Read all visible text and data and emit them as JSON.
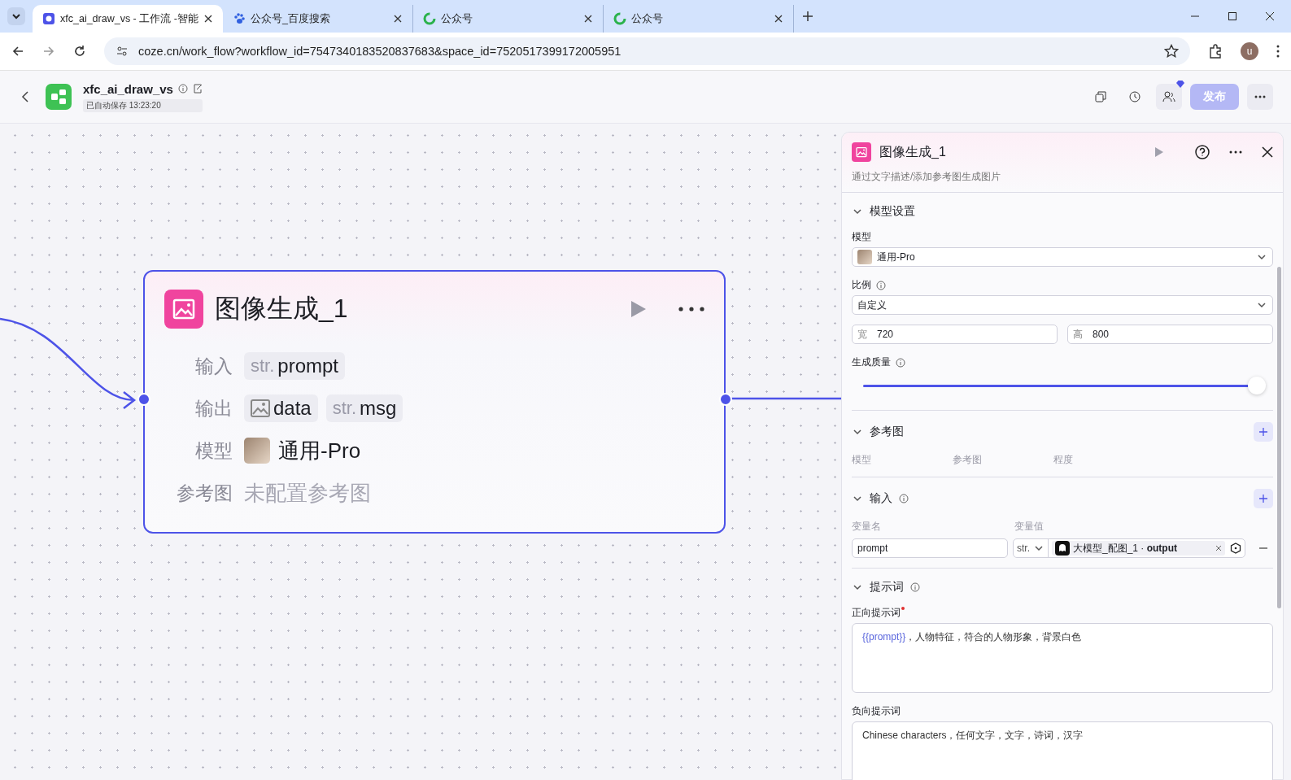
{
  "browser": {
    "tabs": [
      {
        "title": "xfc_ai_draw_vs - 工作流 -智能",
        "selected": true
      },
      {
        "title": "公众号_百度搜索",
        "selected": false
      },
      {
        "title": "公众号",
        "selected": false
      },
      {
        "title": "公众号",
        "selected": false
      }
    ],
    "url": "coze.cn/work_flow?workflow_id=7547340183520837683&space_id=7520517399172005951",
    "profile": "u"
  },
  "header": {
    "title": "xfc_ai_draw_vs",
    "autosave": "已自动保存 13:23:20",
    "publish": "发布"
  },
  "node": {
    "title": "图像生成_1",
    "rows": [
      {
        "label": "输入",
        "values": [
          {
            "kind": "str",
            "prefix": "str.",
            "name": "prompt"
          }
        ]
      },
      {
        "label": "输出",
        "values": [
          {
            "kind": "image",
            "name": "data"
          },
          {
            "kind": "str",
            "prefix": "str.",
            "name": "msg"
          }
        ]
      },
      {
        "label": "模型",
        "values": [
          {
            "kind": "model",
            "name": "通用-Pro"
          }
        ]
      },
      {
        "label": "参考图",
        "values": [
          {
            "kind": "empty",
            "name": "未配置参考图"
          }
        ]
      }
    ]
  },
  "panel": {
    "title": "图像生成_1",
    "description": "通过文字描述/添加参考图生成图片",
    "sections": [
      {
        "kind": "model",
        "title": "模型设置",
        "expanded": true,
        "model_label": "模型",
        "model_value": "通用-Pro",
        "ratio_label": "比例",
        "ratio_value": "自定义",
        "width": {
          "label": "宽",
          "value": "720"
        },
        "height": {
          "label": "高",
          "value": "800"
        },
        "quality_label": "生成质量",
        "level": 1
      },
      {
        "kind": "reference",
        "title": "参考图",
        "expanded": true,
        "columns": [
          "模型",
          "参考图",
          "程度"
        ]
      },
      {
        "kind": "input",
        "title": "输入",
        "expanded": true,
        "columns": [
          "变量名",
          "变量值"
        ],
        "rows": [
          {
            "name": "prompt",
            "type": "str.",
            "source": "大模型_配图_1 · **output**"
          }
        ]
      },
      {
        "kind": "prompt",
        "title": "提示词",
        "expanded": true,
        "positive_label": "正向提示词",
        "positive_required": true,
        "positive_variable": "{{prompt}}",
        "positive_text": "，人物特征，符合的人物形象，背景白色",
        "negative_label": "负向提示词",
        "negative_text": "Chinese characters，任何文字，文字，诗词，汉字"
      }
    ]
  }
}
